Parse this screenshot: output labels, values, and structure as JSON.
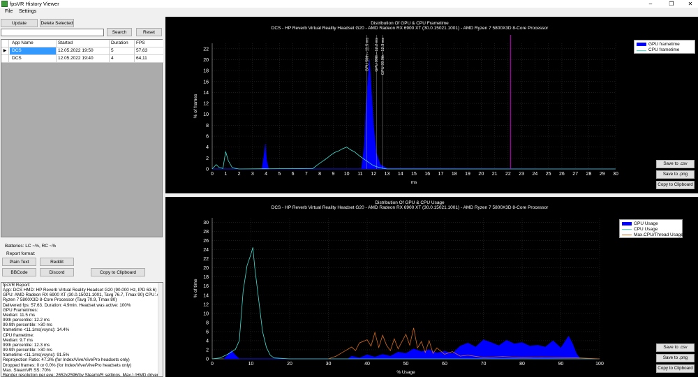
{
  "window": {
    "title": "fpsVR History Viewer",
    "minimize": "–",
    "maximize": "❐",
    "close": "✕"
  },
  "menu": [
    "File",
    "Settings"
  ],
  "toolbar": {
    "update": "Update",
    "delete": "Delete Selected",
    "search": "Search",
    "reset": "Reset",
    "search_value": ""
  },
  "table": {
    "columns": [
      "App Name",
      "Started",
      "Duration",
      "FPS"
    ],
    "rows": [
      {
        "marker": "▶",
        "app": "DCS",
        "started": "12.05.2022 19:50",
        "duration": "5",
        "fps": "57,63"
      },
      {
        "marker": "",
        "app": "DCS",
        "started": "12.05.2022 19:40",
        "duration": "4",
        "fps": "64,11"
      }
    ]
  },
  "batteries": "Batteries: LC ~%, RC ~%",
  "report_format": {
    "label": "Report format:",
    "plain": "Plain Text",
    "reddit": "Reddit",
    "bbcode": "BBCode",
    "discord": "Discord",
    "clipboard": "Copy to Clipboard"
  },
  "report": [
    "fpsVR Report:",
    "App: DCS HMD: HP Reverb Virtual Reality Headset G20 (90.000 Hz, IPD 63.6)",
    "GPU: AMD Radeon RX 6900 XT (30.0.15021.1001, Tavg 76.7, Tmax 90) CPU: AMD",
    "Ryzen 7 5800X3D 8-Core Processor (Tavg 70.9, Tmax 80)",
    "Delivered fps: 57.63. Duration: 4.9min. Headset was active: 100%",
    "GPU Frametimes:",
    "Median: 11.5 ms",
    "99th percentile: 12.2 ms",
    "99.9th percentile: >30 ms",
    "frametime <11.1ms(vsync): 14.4%",
    "CPU frametime:",
    "Median: 9.7 ms",
    "99th percentile: 12.3 ms",
    "99.9th percentile: >30 ms",
    "frametime <11.1ms(vsync): 91.5%",
    "Reprojection Ratio: 47.3% (for Index/Vive/VivePro headsets only)",
    "Dropped frames: 0 or 0.0% (for Index/Vive/VivePro headsets only)",
    "Max. SteamVR SS: 70%",
    "Render resolution per eye: 2652x2596(by SteamVR settings, Max.) (HMD driver"
  ],
  "chart_buttons": {
    "csv": "Save to .csv",
    "png": "Save to .png",
    "clipboard": "Copy to Clipboard"
  },
  "colors": {
    "gpu": "#0000ff",
    "cpu": "#40e0d0",
    "maxcpu": "#d2691e",
    "marker": "#cc00cc"
  },
  "chart_data": [
    {
      "type": "area",
      "title": "Distribution Of GPU & CPU Frametime",
      "subtitle": "DCS - HP Reverb Virtual Reality Headset G20 - AMD Radeon RX 6900 XT (30.0.15021.1001) - AMD Ryzen 7 5800X3D 8-Core Processor",
      "xlabel": "ms",
      "ylabel": "% of frames",
      "xlim": [
        0,
        30
      ],
      "ylim": [
        0,
        23
      ],
      "xticks": [
        0,
        1,
        2,
        3,
        4,
        5,
        6,
        7,
        8,
        9,
        10,
        11,
        12,
        13,
        14,
        15,
        16,
        17,
        18,
        19,
        20,
        21,
        22,
        23,
        24,
        25,
        26,
        27,
        28,
        29,
        30
      ],
      "yticks": [
        0,
        2,
        4,
        6,
        8,
        10,
        12,
        14,
        16,
        18,
        20,
        22
      ],
      "legend": [
        "GPU frametime",
        "CPU frametime"
      ],
      "legend_position": "top-right",
      "annotations": [
        {
          "label": "GPU 50th - 11.5 ms",
          "x": 11.5
        },
        {
          "label": "GPU 99th - 12.2 ms",
          "x": 12.0
        },
        {
          "label": "GPU 99.9th - 12.3 ms",
          "x": 12.25
        }
      ],
      "vsync_line": 22.2,
      "series": [
        {
          "name": "GPU frametime",
          "points": [
            [
              0,
              0
            ],
            [
              3.7,
              0
            ],
            [
              3.85,
              2.5
            ],
            [
              3.95,
              4.6
            ],
            [
              4.05,
              1.6
            ],
            [
              4.2,
              0
            ],
            [
              11.1,
              0
            ],
            [
              11.3,
              4
            ],
            [
              11.45,
              12
            ],
            [
              11.6,
              17
            ],
            [
              11.7,
              20
            ],
            [
              11.85,
              14
            ],
            [
              12.0,
              8
            ],
            [
              12.2,
              3
            ],
            [
              12.5,
              0.8
            ],
            [
              13,
              0.1
            ],
            [
              30,
              0
            ]
          ]
        },
        {
          "name": "CPU frametime",
          "points": [
            [
              0,
              0
            ],
            [
              0.3,
              0.8
            ],
            [
              0.5,
              0.3
            ],
            [
              0.8,
              0.1
            ],
            [
              1.0,
              3.2
            ],
            [
              1.2,
              1.5
            ],
            [
              1.5,
              0.2
            ],
            [
              2,
              0
            ],
            [
              7.5,
              0.1
            ],
            [
              7.8,
              0.7
            ],
            [
              8.2,
              1.4
            ],
            [
              8.5,
              1.9
            ],
            [
              8.8,
              2.5
            ],
            [
              9.1,
              3.0
            ],
            [
              9.4,
              3.3
            ],
            [
              9.7,
              3.7
            ],
            [
              10.0,
              4.0
            ],
            [
              10.3,
              3.5
            ],
            [
              10.6,
              3.1
            ],
            [
              11.0,
              2.3
            ],
            [
              11.4,
              1.6
            ],
            [
              12,
              0.6
            ],
            [
              12.5,
              0.2
            ],
            [
              13,
              0
            ],
            [
              30,
              0
            ]
          ]
        }
      ]
    },
    {
      "type": "area",
      "title": "Distribution Of GPU & CPU Usage",
      "subtitle": "DCS - HP Reverb Virtual Reality Headset G20 - AMD Radeon RX 6900 XT (30.0.15021.1001) - AMD Ryzen 7 5800X3D 8-Core Processor",
      "xlabel": "% Usage",
      "ylabel": "% of time",
      "xlim": [
        0,
        100
      ],
      "ylim": [
        0,
        31
      ],
      "xticks": [
        0,
        10,
        20,
        30,
        40,
        50,
        60,
        70,
        80,
        90,
        100
      ],
      "yticks": [
        0,
        2,
        4,
        6,
        8,
        10,
        12,
        14,
        16,
        18,
        20,
        22,
        24,
        26,
        28,
        30
      ],
      "legend": [
        "GPU Usage",
        "CPU Usage",
        "Max.CPU/Thread Usage"
      ],
      "legend_position": "top-right",
      "series": [
        {
          "name": "GPU Usage",
          "points": [
            [
              3,
              0
            ],
            [
              4,
              0.8
            ],
            [
              5,
              1.8
            ],
            [
              6,
              0.8
            ],
            [
              7,
              0
            ],
            [
              35,
              0
            ],
            [
              36,
              0.6
            ],
            [
              38,
              0.2
            ],
            [
              40,
              0.9
            ],
            [
              42,
              0.4
            ],
            [
              44,
              1.0
            ],
            [
              46,
              0.6
            ],
            [
              48,
              1.5
            ],
            [
              50,
              1.2
            ],
            [
              52,
              2.2
            ],
            [
              54,
              1.6
            ],
            [
              56,
              2.0
            ],
            [
              58,
              1.3
            ],
            [
              60,
              1.7
            ],
            [
              62,
              1.2
            ],
            [
              64,
              2.8
            ],
            [
              66,
              3.5
            ],
            [
              68,
              2.6
            ],
            [
              70,
              4.2
            ],
            [
              72,
              3.6
            ],
            [
              74,
              2.9
            ],
            [
              76,
              4.1
            ],
            [
              78,
              3.3
            ],
            [
              80,
              3.6
            ],
            [
              82,
              2.8
            ],
            [
              84,
              3.0
            ],
            [
              86,
              2.6
            ],
            [
              88,
              4.0
            ],
            [
              90,
              2.4
            ],
            [
              92,
              5.0
            ],
            [
              93,
              3.4
            ],
            [
              94,
              1.2
            ],
            [
              95,
              0
            ],
            [
              100,
              0
            ]
          ]
        },
        {
          "name": "CPU Usage",
          "points": [
            [
              0,
              0
            ],
            [
              2,
              0.2
            ],
            [
              4,
              1.0
            ],
            [
              6,
              2.1
            ],
            [
              7,
              4.0
            ],
            [
              8,
              15.0
            ],
            [
              9,
              20.5
            ],
            [
              10,
              23.0
            ],
            [
              10.5,
              24.5
            ],
            [
              11,
              20
            ],
            [
              12,
              13
            ],
            [
              13,
              6
            ],
            [
              14,
              2.5
            ],
            [
              15,
              0.8
            ],
            [
              16,
              0.2
            ],
            [
              20,
              0
            ],
            [
              100,
              0
            ]
          ]
        },
        {
          "name": "Max.CPU/Thread Usage",
          "points": [
            [
              30,
              0
            ],
            [
              32,
              0.6
            ],
            [
              34,
              1.6
            ],
            [
              36,
              2.6
            ],
            [
              37,
              1.8
            ],
            [
              38,
              3.5
            ],
            [
              40,
              4.2
            ],
            [
              41,
              2.8
            ],
            [
              42,
              5.8
            ],
            [
              43,
              2.5
            ],
            [
              44,
              5.2
            ],
            [
              45,
              3.0
            ],
            [
              46,
              1.8
            ],
            [
              47,
              4.4
            ],
            [
              48,
              2.2
            ],
            [
              49,
              3.8
            ],
            [
              50,
              5.4
            ],
            [
              51,
              3.0
            ],
            [
              52,
              6.8
            ],
            [
              53,
              2.4
            ],
            [
              54,
              3.8
            ],
            [
              55,
              1.4
            ],
            [
              56,
              4.0
            ],
            [
              57,
              1.2
            ],
            [
              58,
              2.4
            ],
            [
              60,
              1.0
            ],
            [
              62,
              1.6
            ],
            [
              64,
              0.6
            ],
            [
              66,
              0.8
            ],
            [
              70,
              0.3
            ],
            [
              75,
              0.5
            ],
            [
              80,
              0.3
            ],
            [
              85,
              0.4
            ],
            [
              90,
              0.3
            ],
            [
              95,
              0.2
            ],
            [
              100,
              0
            ]
          ]
        }
      ]
    }
  ]
}
